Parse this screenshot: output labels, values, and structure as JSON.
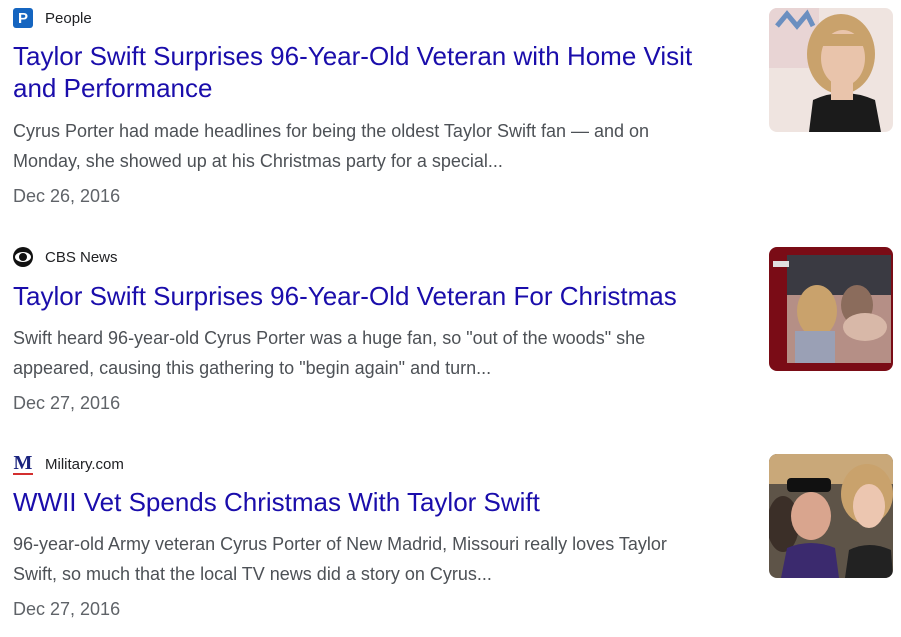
{
  "results": [
    {
      "source": "People",
      "source_icon": "people-logo-icon",
      "headline": "Taylor Swift Surprises 96-Year-Old Veteran with Home Visit and Performance",
      "snippet": "Cyrus Porter had made headlines for being the oldest Taylor Swift fan — and on Monday, she showed up at his Christmas party for a special...",
      "date": "Dec 26, 2016",
      "thumbnail": "singer-red-carpet-thumbnail"
    },
    {
      "source": "CBS News",
      "source_icon": "cbs-eye-logo-icon",
      "headline": "Taylor Swift Surprises 96-Year-Old Veteran For Christmas",
      "snippet": "Swift heard 96-year-old Cyrus Porter was a huge fan, so \"out of the woods\" she appeared, causing this gathering to \"begin again\" and turn...",
      "date": "Dec 27, 2016",
      "thumbnail": "christmas-party-video-thumbnail"
    },
    {
      "source": "Military.com",
      "source_icon": "military-m-logo-icon",
      "headline": "WWII Vet Spends Christmas With Taylor Swift",
      "snippet": "96-year-old Army veteran Cyrus Porter of New Madrid, Missouri really loves Taylor Swift, so much that the local TV news did a story on Cyrus...",
      "date": "Dec 27, 2016",
      "thumbnail": "veteran-selfie-thumbnail"
    }
  ],
  "icons": {
    "people_glyph": "P",
    "military_glyph": "M"
  },
  "colors": {
    "headline": "#1a0dab",
    "snippet": "#4d5156",
    "date": "#5f6368",
    "people_brand": "#1565c0",
    "military_brand": "#1a237e"
  }
}
